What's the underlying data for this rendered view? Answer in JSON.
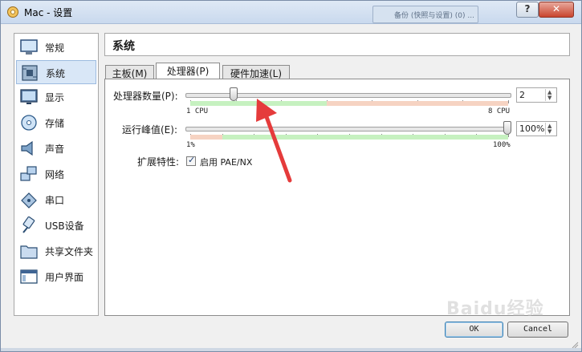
{
  "window": {
    "title": "Mac - 设置",
    "background_tab": "备份 (快照与设置) (0) ..."
  },
  "titlebar_buttons": {
    "help": "?",
    "close": "✕"
  },
  "sidebar": {
    "items": [
      {
        "label": "常规",
        "icon": "monitor-icon"
      },
      {
        "label": "系统",
        "icon": "motherboard-icon"
      },
      {
        "label": "显示",
        "icon": "display-icon"
      },
      {
        "label": "存储",
        "icon": "disk-icon"
      },
      {
        "label": "声音",
        "icon": "speaker-icon"
      },
      {
        "label": "网络",
        "icon": "network-icon"
      },
      {
        "label": "串口",
        "icon": "serial-port-icon"
      },
      {
        "label": "USB设备",
        "icon": "usb-icon"
      },
      {
        "label": "共享文件夹",
        "icon": "folder-icon"
      },
      {
        "label": "用户界面",
        "icon": "window-icon"
      }
    ],
    "selected": "系统"
  },
  "section_title": "系统",
  "tabs": [
    {
      "label": "主板(M)"
    },
    {
      "label": "处理器(P)"
    },
    {
      "label": "硬件加速(L)"
    }
  ],
  "active_tab": "处理器(P)",
  "processor": {
    "cpu_count_label": "处理器数量(P):",
    "cpu_min_label": "1 CPU",
    "cpu_max_label": "8 CPU",
    "cpu_value": "2",
    "cpu_value_num": 2,
    "cpu_max": 8,
    "exec_cap_label": "运行峰值(E):",
    "exec_min_label": "1%",
    "exec_max_label": "100%",
    "exec_value": "100%",
    "exec_value_num": 100,
    "ext_features_label": "扩展特性:",
    "pae_label": "启用 PAE/NX",
    "pae_checked": true
  },
  "buttons": {
    "ok": "OK",
    "cancel": "Cancel"
  },
  "watermark": "Baidu经验",
  "colors": {
    "zone_green": "#c6f1c0",
    "zone_orange": "#f6d3c2",
    "annotation_arrow": "#e53b3b"
  }
}
